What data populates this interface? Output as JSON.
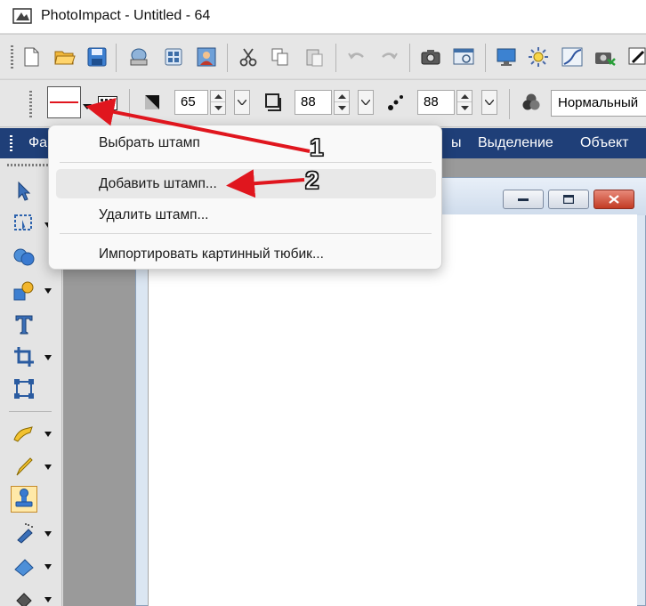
{
  "window": {
    "title": "PhotoImpact - Untitled - 64"
  },
  "toolbar2": {
    "value1": "65",
    "value2": "88",
    "value3": "88",
    "blend_mode": "Нормальный"
  },
  "menubar": {
    "items": [
      {
        "label": "Фа"
      },
      {
        "label": "ы"
      },
      {
        "label": "Выделение"
      },
      {
        "label": "Объект"
      }
    ]
  },
  "popup": {
    "items": [
      {
        "label": "Выбрать штамп"
      },
      {
        "label": "Добавить штамп..."
      },
      {
        "label": "Удалить штамп..."
      },
      {
        "label": "Импортировать картинный тюбик..."
      }
    ]
  },
  "annotations": {
    "marker1": "1",
    "marker2": "2",
    "arrow_color": "#e0161e"
  },
  "colors": {
    "menubar": "#1f3f78",
    "close_button": "#c23b24",
    "active_tool": "#ffe9a8"
  }
}
